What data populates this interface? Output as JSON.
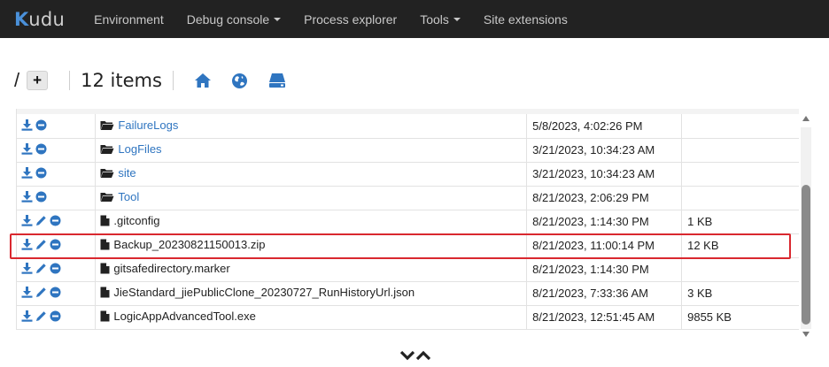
{
  "navbar": {
    "brand_first": "K",
    "brand_rest": "udu",
    "items": [
      {
        "label": "Environment",
        "dropdown": false
      },
      {
        "label": "Debug console",
        "dropdown": true
      },
      {
        "label": "Process explorer",
        "dropdown": false
      },
      {
        "label": "Tools",
        "dropdown": true
      },
      {
        "label": "Site extensions",
        "dropdown": false
      }
    ]
  },
  "toolbar": {
    "path": "/",
    "add_label": "+",
    "item_count": "12 items",
    "icons": [
      "home-icon",
      "globe-icon",
      "drive-icon"
    ]
  },
  "files": {
    "rows": [
      {
        "name": "FailureLogs",
        "type": "folder",
        "modified": "5/8/2023, 4:02:26 PM",
        "size": "",
        "editable": false
      },
      {
        "name": "LogFiles",
        "type": "folder",
        "modified": "3/21/2023, 10:34:23 AM",
        "size": "",
        "editable": false
      },
      {
        "name": "site",
        "type": "folder",
        "modified": "3/21/2023, 10:34:23 AM",
        "size": "",
        "editable": false
      },
      {
        "name": "Tool",
        "type": "folder",
        "modified": "8/21/2023, 2:06:29 PM",
        "size": "",
        "editable": false
      },
      {
        "name": ".gitconfig",
        "type": "file",
        "modified": "8/21/2023, 1:14:30 PM",
        "size": "1 KB",
        "editable": true
      },
      {
        "name": "Backup_20230821150013.zip",
        "type": "file",
        "modified": "8/21/2023, 11:00:14 PM",
        "size": "12 KB",
        "editable": true
      },
      {
        "name": "gitsafedirectory.marker",
        "type": "file",
        "modified": "8/21/2023, 1:14:30 PM",
        "size": "",
        "editable": true
      },
      {
        "name": "JieStandard_jiePublicClone_20230727_RunHistoryUrl.json",
        "type": "file",
        "modified": "8/21/2023, 7:33:36 AM",
        "size": "3 KB",
        "editable": true
      },
      {
        "name": "LogicAppAdvancedTool.exe",
        "type": "file",
        "modified": "8/21/2023, 12:51:45 AM",
        "size": "9855 KB",
        "editable": true
      }
    ]
  },
  "colors": {
    "accent": "#2f75c0",
    "navbar_bg": "#222222",
    "highlight": "#d9282f"
  }
}
